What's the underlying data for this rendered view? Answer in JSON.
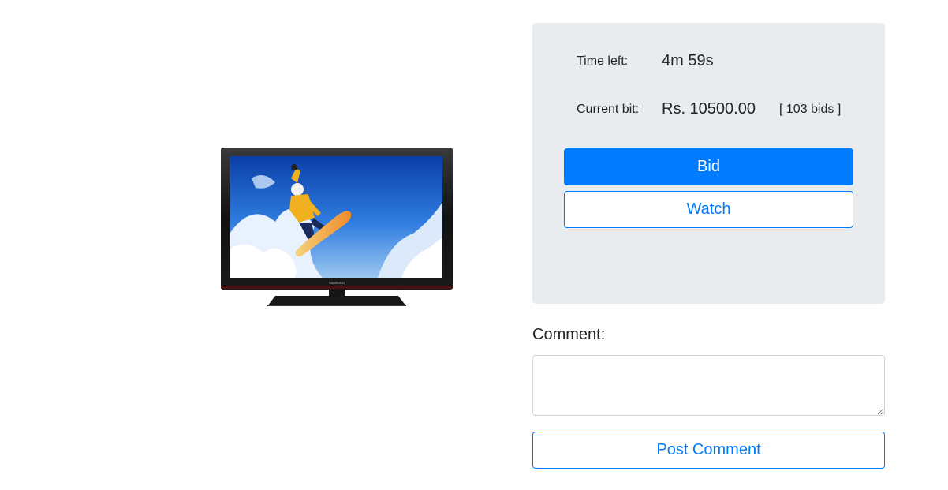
{
  "product": {
    "image_icon": "television-image",
    "brand_mark": "SAMSUNG"
  },
  "auction": {
    "time_left_label": "Time left:",
    "time_left_value": "4m 59s",
    "current_bid_label": "Current bit:",
    "current_bid_value": "Rs. 10500.00",
    "bids_count": "[ 103 bids ]",
    "bid_button": "Bid",
    "watch_button": "Watch"
  },
  "comment": {
    "label": "Comment:",
    "placeholder": "",
    "value": "",
    "post_button": "Post Comment"
  },
  "colors": {
    "primary": "#007bff",
    "panel_bg": "#e9ecef",
    "text": "#212529"
  }
}
